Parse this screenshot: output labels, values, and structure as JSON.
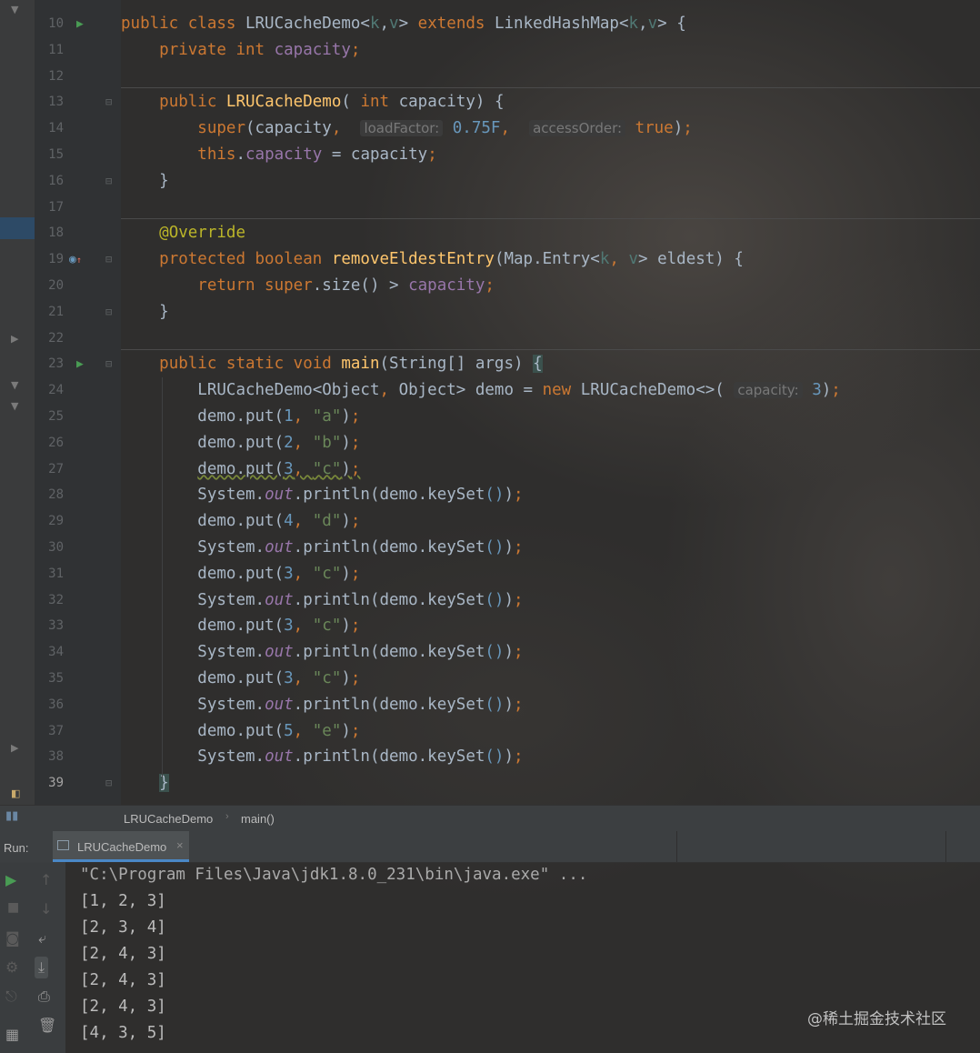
{
  "editor": {
    "lines": [
      {
        "n": "10",
        "html": "<span class=\"kw\">public class </span><span class=\"cls\">LRUCacheDemo</span><span class=\"punct\">&lt;</span><span class=\"tp\">k</span><span class=\"punct\">,</span><span class=\"tp\">v</span><span class=\"punct\">&gt; </span><span class=\"kw\">extends </span><span class=\"cls\">LinkedHashMap</span><span class=\"punct\">&lt;</span><span class=\"tp\">k</span><span class=\"punct\">,</span><span class=\"tp\">v</span><span class=\"punct\">&gt; {</span>"
      },
      {
        "n": "11",
        "html": "    <span class=\"kw\">private int </span><span class=\"fld\">capacity</span><span class=\"kw\">;</span>"
      },
      {
        "n": "12",
        "html": ""
      },
      {
        "n": "13",
        "html": "    <span class=\"kw\">public </span><span class=\"fn\">LRUCacheDemo</span><span class=\"punct\">( </span><span class=\"kw\">int </span><span class=\"cls\">capacity</span><span class=\"punct\">) {</span>"
      },
      {
        "n": "14",
        "html": "        <span class=\"kw\">super</span><span class=\"punct\">(capacity</span><span class=\"kw\">, </span> <span class=\"hint\">loadFactor:</span> <span class=\"num\">0.75F</span><span class=\"kw\">, </span> <span class=\"hint\">accessOrder:</span> <span class=\"kw\">true</span><span class=\"punct\">)</span><span class=\"kw\">;</span>"
      },
      {
        "n": "15",
        "html": "        <span class=\"kw\">this</span><span class=\"punct\">.</span><span class=\"fld\">capacity</span><span class=\"punct\"> = capacity</span><span class=\"kw\">;</span>"
      },
      {
        "n": "16",
        "html": "    <span class=\"punct\">}</span>"
      },
      {
        "n": "17",
        "html": ""
      },
      {
        "n": "18",
        "html": "    <span class=\"ann\">@Override</span>"
      },
      {
        "n": "19",
        "html": "    <span class=\"kw\">protected boolean </span><span class=\"fn\">removeEldestEntry</span><span class=\"punct\">(Map.Entry&lt;</span><span class=\"tp\">k</span><span class=\"kw\">, </span><span class=\"tp\">v</span><span class=\"punct\">&gt; eldest) {</span>"
      },
      {
        "n": "20",
        "html": "        <span class=\"kw\">return super</span><span class=\"punct\">.size() &gt; </span><span class=\"fld\">capacity</span><span class=\"kw\">;</span>"
      },
      {
        "n": "21",
        "html": "    <span class=\"punct\">}</span>"
      },
      {
        "n": "22",
        "html": ""
      },
      {
        "n": "23",
        "html": "    <span class=\"kw\">public static void </span><span class=\"fn\">main</span><span class=\"punct\">(String[] args) </span><span class=\"brace-hl\">{</span>"
      },
      {
        "n": "24",
        "html": "        <span class=\"punct\">LRUCacheDemo&lt;Object</span><span class=\"kw\">, </span><span class=\"punct\">Object&gt; demo = </span><span class=\"kw\">new </span><span class=\"punct\">LRUCacheDemo&lt;&gt;( </span><span class=\"hint\">capacity:</span> <span class=\"num\">3</span><span class=\"punct\">)</span><span class=\"kw\">;</span>"
      },
      {
        "n": "25",
        "html": "        <span class=\"punct\">demo.put(</span><span class=\"num\">1</span><span class=\"kw\">, </span><span class=\"str\">\"a\"</span><span class=\"punct\">)</span><span class=\"kw\">;</span>"
      },
      {
        "n": "26",
        "html": "        <span class=\"punct\">demo.put(</span><span class=\"num\">2</span><span class=\"kw\">, </span><span class=\"str\">\"b\"</span><span class=\"punct\">)</span><span class=\"kw\">;</span>"
      },
      {
        "n": "27",
        "html": "        <span class=\"squiggle\"><span class=\"punct\">demo.put(</span><span class=\"num\">3</span><span class=\"kw\">, </span><span class=\"str\">\"c\"</span><span class=\"punct\">)</span><span class=\"kw\">;</span></span>"
      },
      {
        "n": "28",
        "html": "        <span class=\"punct\">System.</span><span class=\"st\">out</span><span class=\"punct\">.println(demo.keySet</span><span class=\"num\">()</span><span class=\"punct\">)</span><span class=\"kw\">;</span>"
      },
      {
        "n": "29",
        "html": "        <span class=\"punct\">demo.put(</span><span class=\"num\">4</span><span class=\"kw\">, </span><span class=\"str\">\"d\"</span><span class=\"punct\">)</span><span class=\"kw\">;</span>"
      },
      {
        "n": "30",
        "html": "        <span class=\"punct\">System.</span><span class=\"st\">out</span><span class=\"punct\">.println(demo.keySet</span><span class=\"num\">()</span><span class=\"punct\">)</span><span class=\"kw\">;</span>"
      },
      {
        "n": "31",
        "html": "        <span class=\"punct\">demo.put(</span><span class=\"num\">3</span><span class=\"kw\">, </span><span class=\"str\">\"c\"</span><span class=\"punct\">)</span><span class=\"kw\">;</span>"
      },
      {
        "n": "32",
        "html": "        <span class=\"punct\">System.</span><span class=\"st\">out</span><span class=\"punct\">.println(demo.keySet</span><span class=\"num\">()</span><span class=\"punct\">)</span><span class=\"kw\">;</span>"
      },
      {
        "n": "33",
        "html": "        <span class=\"punct\">demo.put(</span><span class=\"num\">3</span><span class=\"kw\">, </span><span class=\"str\">\"c\"</span><span class=\"punct\">)</span><span class=\"kw\">;</span>"
      },
      {
        "n": "34",
        "html": "        <span class=\"punct\">System.</span><span class=\"st\">out</span><span class=\"punct\">.println(demo.keySet</span><span class=\"num\">()</span><span class=\"punct\">)</span><span class=\"kw\">;</span>"
      },
      {
        "n": "35",
        "html": "        <span class=\"punct\">demo.put(</span><span class=\"num\">3</span><span class=\"kw\">, </span><span class=\"str\">\"c\"</span><span class=\"punct\">)</span><span class=\"kw\">;</span>"
      },
      {
        "n": "36",
        "html": "        <span class=\"punct\">System.</span><span class=\"st\">out</span><span class=\"punct\">.println(demo.keySet</span><span class=\"num\">()</span><span class=\"punct\">)</span><span class=\"kw\">;</span>"
      },
      {
        "n": "37",
        "html": "        <span class=\"punct\">demo.put(</span><span class=\"num\">5</span><span class=\"kw\">, </span><span class=\"str\">\"e\"</span><span class=\"punct\">)</span><span class=\"kw\">;</span>"
      },
      {
        "n": "38",
        "html": "        <span class=\"punct\">System.</span><span class=\"st\">out</span><span class=\"punct\">.println(demo.keySet</span><span class=\"num\">()</span><span class=\"punct\">)</span><span class=\"kw\">;</span>"
      },
      {
        "n": "39",
        "html": "    <span class=\"brace-hl\">}</span>"
      }
    ]
  },
  "breadcrumb": {
    "class_name": "LRUCacheDemo",
    "method": "main()"
  },
  "run_panel": {
    "label": "Run:",
    "tab_label": "LRUCacheDemo",
    "close_glyph": "×"
  },
  "console": {
    "command": "\"C:\\Program Files\\Java\\jdk1.8.0_231\\bin\\java.exe\" ...",
    "outputs": [
      "[1, 2, 3]",
      "[2, 3, 4]",
      "[2, 4, 3]",
      "[2, 4, 3]",
      "[2, 4, 3]",
      "[4, 3, 5]"
    ]
  },
  "icons": {
    "run_gutter": "run-gutter-icon",
    "override": "override-marker-icon",
    "fold": "fold-marker-icon"
  },
  "colors": {
    "keyword": "#cc7832",
    "method": "#ffc66d",
    "field": "#9876aa",
    "string": "#6a8759",
    "number": "#6897bb",
    "annotation": "#bbb529",
    "run_green": "#499c54"
  },
  "watermark": "@稀土掘金技术社区"
}
